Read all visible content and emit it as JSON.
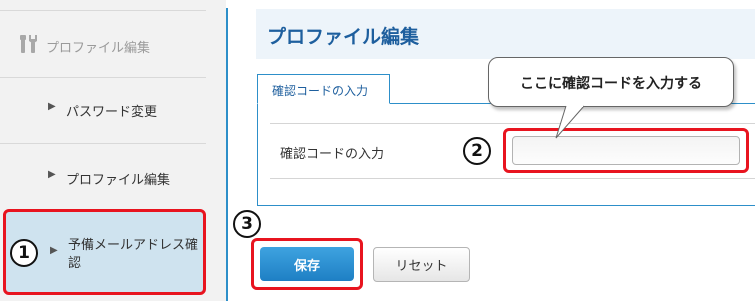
{
  "sidebar": {
    "header": {
      "label": "プロファイル編集",
      "icon": "tools-icon"
    },
    "items": [
      {
        "label": "パスワード変更",
        "icon": "triangle-right-icon"
      },
      {
        "label": "プロファイル編集",
        "icon": "triangle-right-icon"
      },
      {
        "label": "予備メールアドレス確認",
        "icon": "triangle-right-icon"
      }
    ]
  },
  "main": {
    "title": "プロファイル編集",
    "tab_label": "確認コードの入力",
    "field_label": "確認コードの入力",
    "code_input": {
      "value": "",
      "placeholder": ""
    },
    "callout_text": "ここに確認コードを入力する",
    "save_label": "保存",
    "reset_label": "リセット"
  },
  "annotations": {
    "step1": "1",
    "step2": "2",
    "step3": "3"
  },
  "colors": {
    "accent": "#2d8fc9",
    "highlight": "#e8141f",
    "selected_bg": "#cfe3ef",
    "title": "#1e5f9e"
  }
}
